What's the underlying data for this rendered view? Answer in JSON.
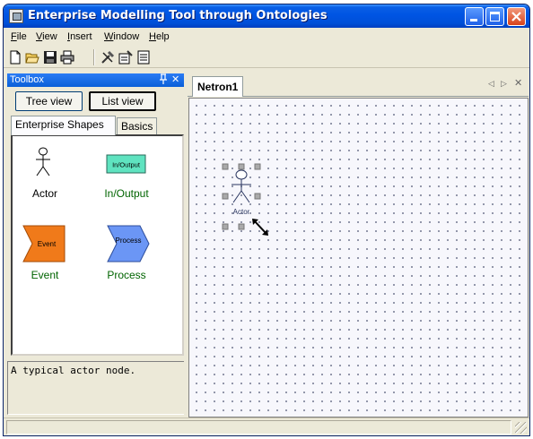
{
  "window": {
    "title": "Enterprise Modelling Tool through Ontologies"
  },
  "menu": [
    {
      "label": "File",
      "accel": "F",
      "rest": "ile"
    },
    {
      "label": "View",
      "accel": "V",
      "rest": "iew"
    },
    {
      "label": "Insert",
      "accel": "I",
      "rest": "nsert"
    },
    {
      "label": "Window",
      "accel": "W",
      "rest": "indow"
    },
    {
      "label": "Help",
      "accel": "H",
      "rest": "elp"
    }
  ],
  "toolbar": [
    "new-icon",
    "open-icon",
    "save-icon",
    "print-icon",
    "tools-icon",
    "properties-icon",
    "document-icon"
  ],
  "toolbox": {
    "title": "Toolbox",
    "pin": "■",
    "close": "✕",
    "tree_view": "Tree view",
    "list_view": "List view",
    "tabs": [
      "Enterprise Shapes",
      "Basics"
    ],
    "shapes": {
      "actor": "Actor",
      "io": "In/Output",
      "io_icon": "In/Output",
      "event": "Event",
      "event_icon": "Event",
      "process": "Process",
      "process_icon": "Process"
    },
    "description": "A typical actor node."
  },
  "document": {
    "tab": "Netron1",
    "nav_left": "◁",
    "nav_right": "▷",
    "close": "✕",
    "actor_label": "Actor"
  },
  "colors": {
    "io_fill": "#5fe3c0",
    "event_fill": "#f07a1a",
    "process_fill": "#6b96f5",
    "label_green": "#006400"
  }
}
